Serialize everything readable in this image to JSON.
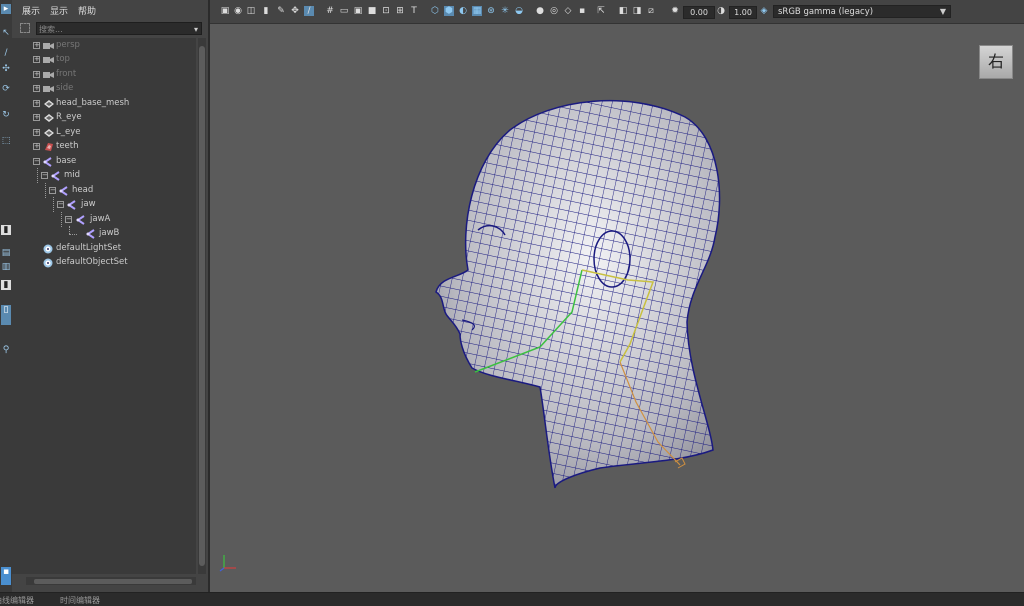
{
  "menu": [
    "展示",
    "显示",
    "帮助"
  ],
  "search": {
    "placeholder": "搜索..."
  },
  "outliner": {
    "items": [
      {
        "label": "persp",
        "icon": "camera-icon",
        "dim": true
      },
      {
        "label": "top",
        "icon": "camera-icon",
        "dim": true
      },
      {
        "label": "front",
        "icon": "camera-icon",
        "dim": true
      },
      {
        "label": "side",
        "icon": "camera-icon",
        "dim": true
      },
      {
        "label": "head_base_mesh",
        "icon": "mesh-icon",
        "dim": false
      },
      {
        "label": "R_eye",
        "icon": "mesh-icon",
        "dim": false
      },
      {
        "label": "L_eye",
        "icon": "mesh-icon",
        "dim": false
      },
      {
        "label": "teeth",
        "icon": "mesh-icon",
        "dim": false
      },
      {
        "label": "base",
        "icon": "joint-icon",
        "dim": false
      },
      {
        "label": "mid",
        "icon": "joint-icon",
        "dim": false
      },
      {
        "label": "head",
        "icon": "joint-icon",
        "dim": false
      },
      {
        "label": "jaw",
        "icon": "joint-icon",
        "dim": false
      },
      {
        "label": "jawA",
        "icon": "joint-icon",
        "dim": false
      },
      {
        "label": "jawB",
        "icon": "joint-icon",
        "dim": false
      },
      {
        "label": "defaultLightSet",
        "icon": "set-icon",
        "dim": false
      },
      {
        "label": "defaultObjectSet",
        "icon": "set-icon",
        "dim": false
      }
    ]
  },
  "viewport": {
    "exposure": "0.00",
    "gamma": "1.00",
    "color_management": "sRGB gamma (legacy)",
    "view_cube_label": "右"
  },
  "statusbar": {
    "tabs": [
      "曲线编辑器",
      "时间编辑器"
    ]
  },
  "colors": {
    "mesh_wire": "#1a1a80",
    "joint_green": "#3cc040",
    "joint_yellow": "#c8c040"
  }
}
